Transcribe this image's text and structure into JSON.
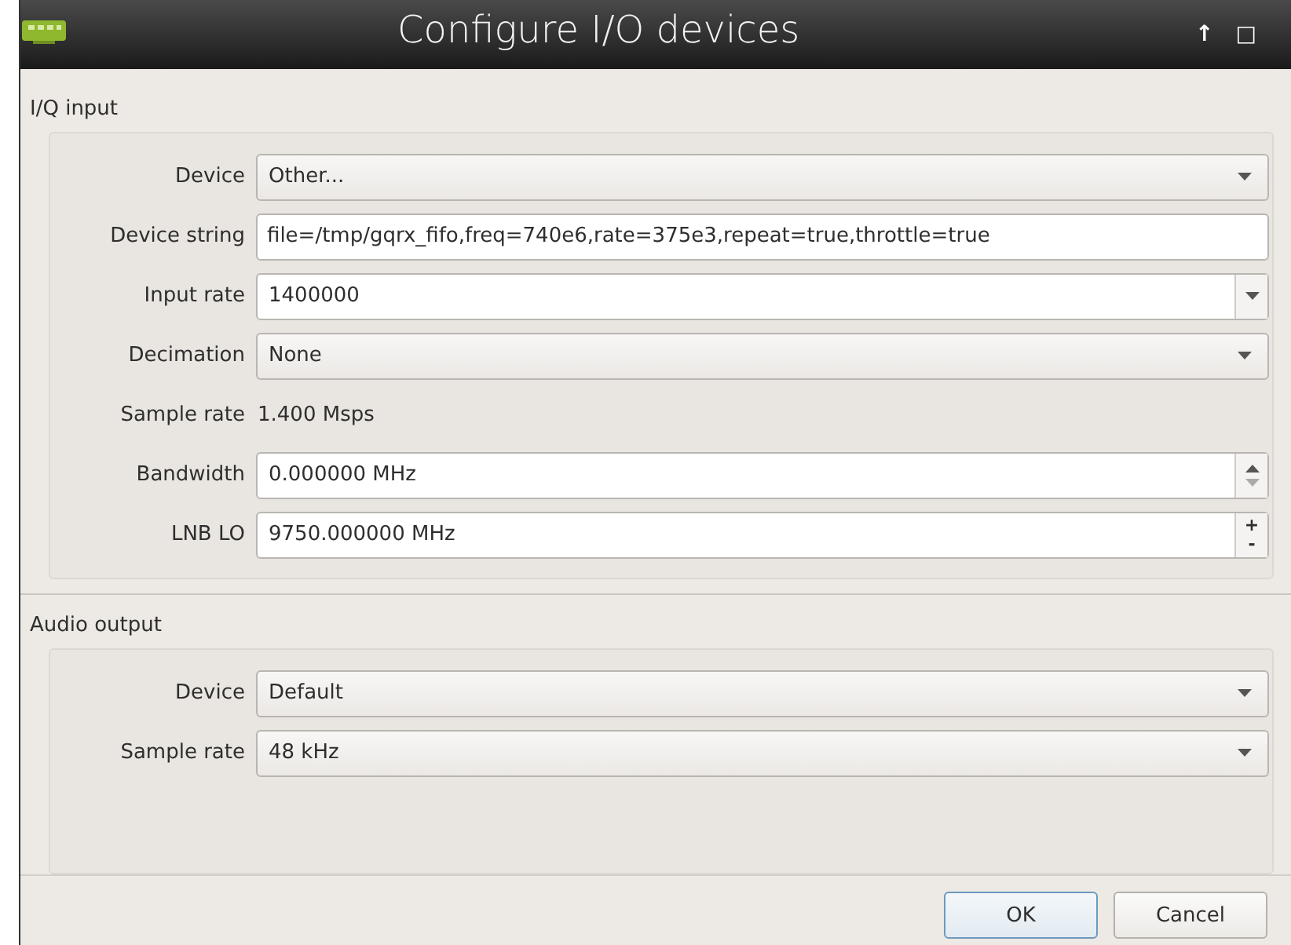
{
  "window": {
    "title": "Configure I/O devices",
    "controls": [
      "↑",
      "□"
    ]
  },
  "groups": [
    {
      "title": "I/Q input",
      "rows": [
        {
          "kind": "dropdown",
          "label": "Device",
          "value": "Other..."
        },
        {
          "kind": "text",
          "label": "Device string",
          "value": "file=/tmp/gqrx_fifo,freq=740e6,rate=375e3,repeat=true,throttle=true"
        },
        {
          "kind": "editable-dropdown",
          "label": "Input rate",
          "value": "1400000"
        },
        {
          "kind": "dropdown",
          "label": "Decimation",
          "value": "None"
        },
        {
          "kind": "readout",
          "label": "Sample rate",
          "value": "1.400 Msps"
        },
        {
          "kind": "spin-arrows",
          "label": "Bandwidth",
          "value": "0.000000 MHz",
          "down_disabled": true
        },
        {
          "kind": "spin-plusminus",
          "label": "LNB LO",
          "value": "9750.000000 MHz",
          "buttons": [
            "+",
            "-"
          ]
        }
      ]
    },
    {
      "title": "Audio output",
      "rows": [
        {
          "kind": "dropdown",
          "label": "Device",
          "value": "Default"
        },
        {
          "kind": "dropdown",
          "label": "Sample rate",
          "value": "48 kHz"
        }
      ]
    }
  ],
  "buttons": [
    {
      "label": "OK",
      "default": true
    },
    {
      "label": "Cancel",
      "default": false
    }
  ]
}
